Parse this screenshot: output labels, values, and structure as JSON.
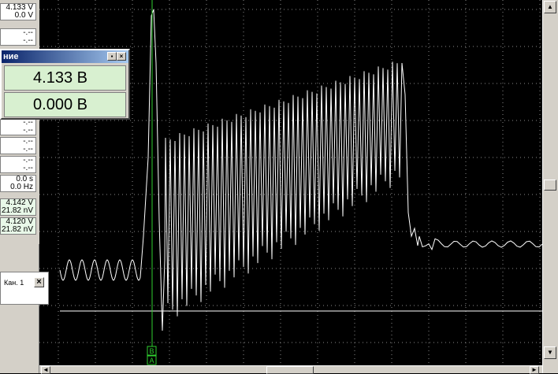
{
  "left_panel": {
    "readouts": [
      [
        "4.133 V",
        "0.0 V"
      ],
      [
        "-.--",
        "-.--"
      ],
      [
        "-.--",
        "-.--"
      ],
      [
        "-.--",
        "-.--"
      ],
      [
        "-.--",
        "-.--"
      ],
      [
        "0.0 s",
        "0.0 Hz"
      ],
      [
        "4.142 V",
        "21.82 nV"
      ],
      [
        "4.120 V",
        "21.82 nV"
      ]
    ]
  },
  "measurement_window": {
    "title": "ние",
    "value_a": "4.133 В",
    "value_b": "0.000 В"
  },
  "channel": {
    "label": "Кан. 1"
  },
  "cursors": {
    "b_label": "B",
    "a_label": "A"
  },
  "colors": {
    "trace": "#ffffff",
    "cursor": "#2fd02f",
    "grid": "#8a8a8a",
    "background": "#000000"
  }
}
